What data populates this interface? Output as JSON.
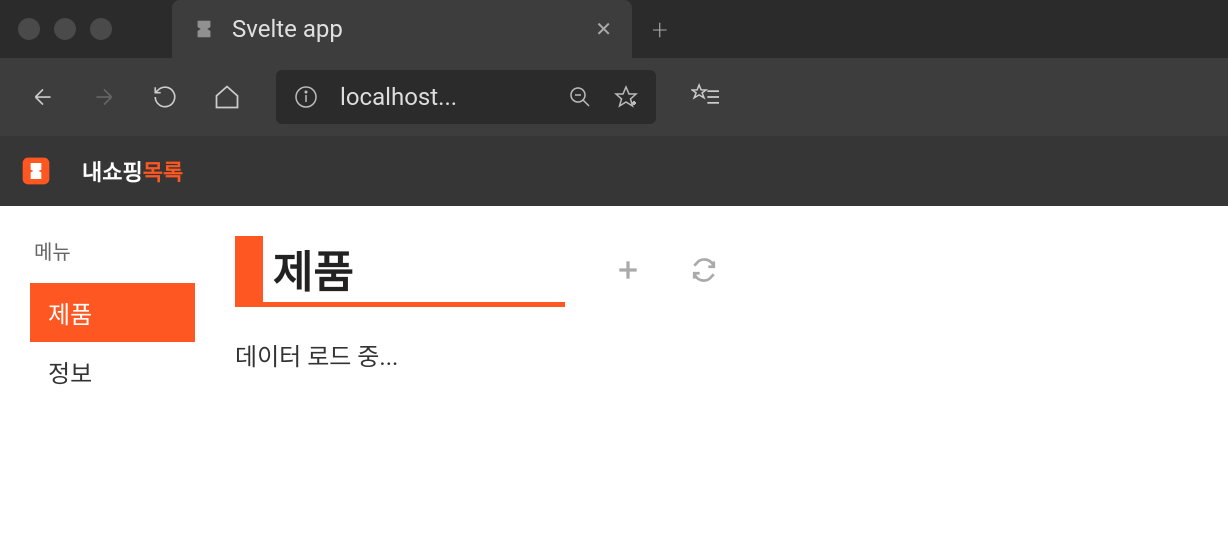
{
  "browser": {
    "tab_title": "Svelte app",
    "address": "localhost..."
  },
  "app": {
    "title_part1": "내쇼핑",
    "title_part2": "목록"
  },
  "sidebar": {
    "heading": "메뉴",
    "items": [
      {
        "label": "제품",
        "active": true
      },
      {
        "label": "정보",
        "active": false
      }
    ]
  },
  "main": {
    "title": "제품",
    "loading_text": "데이터 로드 중..."
  }
}
